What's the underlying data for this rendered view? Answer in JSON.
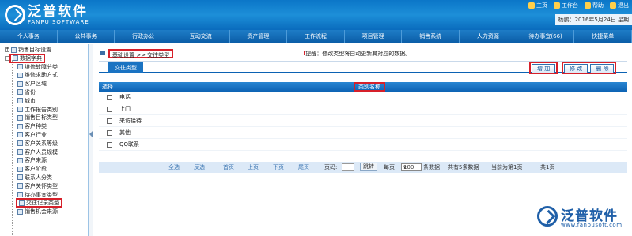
{
  "app": {
    "logo_cn": "泛普软件",
    "logo_en": "FANPU SOFTWARE"
  },
  "toplinks": [
    "主页",
    "工作台",
    "帮助",
    "退出"
  ],
  "userbar": "杨鹏：2016年5月24日 星期",
  "menu": [
    "个人事务",
    "公共事务",
    "行政办公",
    "互动交流",
    "资产管理",
    "工作流程",
    "项目管理",
    "销售系统",
    "人力资源",
    "待办事宜(66)",
    "快捷菜单"
  ],
  "sidebar": {
    "top_item": "销售目标设置",
    "folder": "数据字典",
    "items": [
      "维修故障分类",
      "维修求助方式",
      "客户区域",
      "省份",
      "城市",
      "工作报告类别",
      "销售目标类型",
      "客户种类",
      "客户行业",
      "客户关系等级",
      "客户人员规模",
      "客户来源",
      "客户阶段",
      "联系人分类",
      "客户关怀类型",
      "待办事宜类型",
      "交往记录类型",
      "销售机会来源"
    ]
  },
  "breadcrumb": "基础设置 >> 交往类型",
  "tip_mark": "!",
  "tip": "提醒：修改类型将自动更新其对应的数据。",
  "tab": "交往类型",
  "buttons": {
    "add": "增 加",
    "edit": "修 改",
    "delete": "删 除"
  },
  "grid": {
    "col_select": "选择",
    "col_name": "类别名称",
    "rows": [
      "电话",
      "上门",
      "来访接待",
      "其他",
      "QQ联系"
    ]
  },
  "pager": {
    "select_all": "全选",
    "invert": "反选",
    "first": "首页",
    "prev": "上页",
    "next": "下页",
    "last": "尾页",
    "page_code": "页码:",
    "jump": "跳转",
    "per_page": "每页",
    "per_page_value": "100",
    "per_page_unit": "条数据",
    "total": "共有5条数据",
    "current": "当前为第1页",
    "pages": "共1页"
  },
  "brand": {
    "cn": "泛普软件",
    "url": "www.fanpusoft.com"
  }
}
